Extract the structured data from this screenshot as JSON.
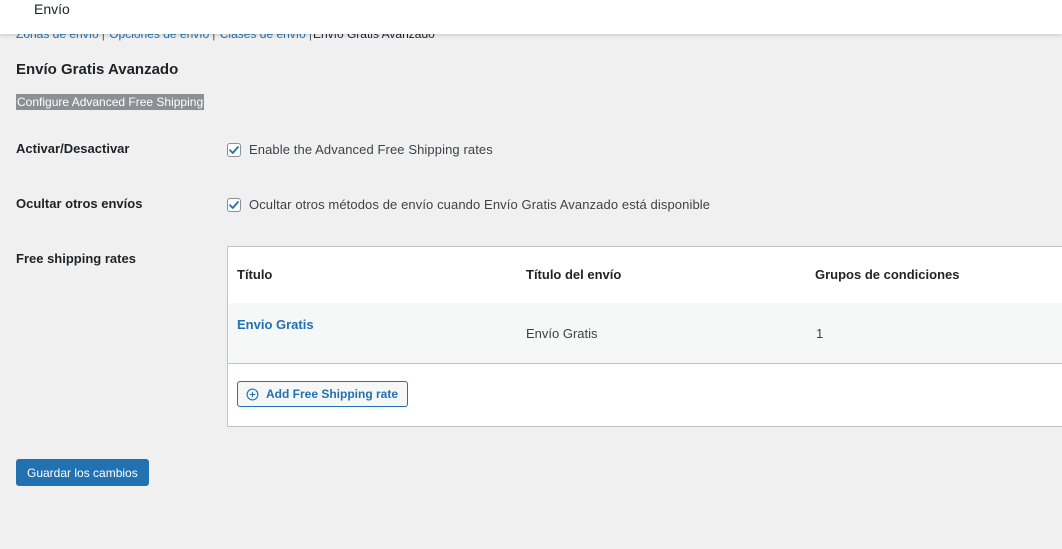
{
  "header": {
    "title": "Envío"
  },
  "subnav": {
    "items": [
      {
        "label": "Zonas de envío",
        "link": true
      },
      {
        "label": "Opciones de envío",
        "link": true
      },
      {
        "label": "Clases de envío",
        "link": true
      },
      {
        "label": "Envío Gratis Avanzado",
        "link": false
      }
    ],
    "separator": "|"
  },
  "section": {
    "title": "Envío Gratis Avanzado",
    "description": "Configure Advanced Free Shipping"
  },
  "fields": {
    "enable": {
      "label": "Activar/Desactivar",
      "checkbox_label": "Enable the Advanced Free Shipping rates",
      "checked": true
    },
    "hide_others": {
      "label": "Ocultar otros envíos",
      "checkbox_label": "Ocultar otros métodos de envío cuando Envío Gratis Avanzado está disponible",
      "checked": true
    },
    "rates": {
      "label": "Free shipping rates"
    }
  },
  "rates_table": {
    "columns": [
      "Título",
      "Título del envío",
      "Grupos de condiciones"
    ],
    "rows": [
      {
        "title": "Envio Gratis",
        "shipping_title": "Envío Gratis",
        "condition_groups": "1"
      }
    ],
    "add_button": "Add Free Shipping rate"
  },
  "save_button": "Guardar los cambios",
  "colors": {
    "accent": "#2271b1",
    "background": "#f0f0f1"
  }
}
